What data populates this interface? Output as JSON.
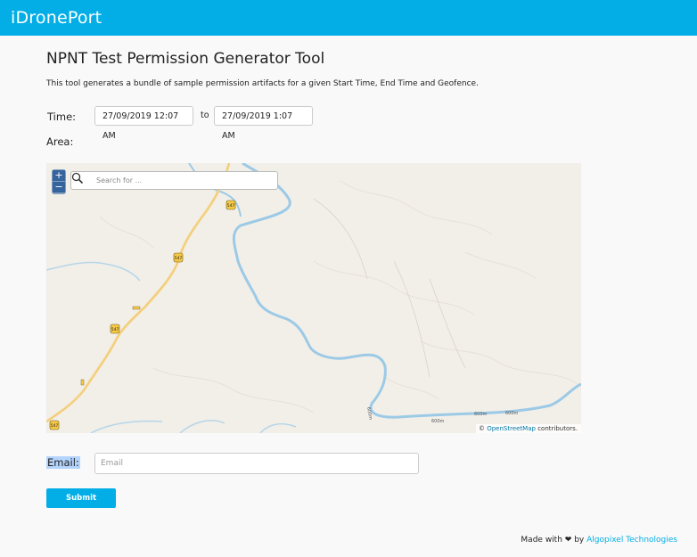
{
  "header": {
    "brand": "iDronePort",
    "color": "#03aee6"
  },
  "page": {
    "title": "NPNT Test Permission Generator Tool",
    "description": "This tool generates a bundle of sample permission artifacts for a given Start Time, End Time and Geofence."
  },
  "form": {
    "time_label": "Time:",
    "start_time": "27/09/2019 12:07 AM",
    "to_label": "to",
    "end_time": "27/09/2019 1:07 AM",
    "area_label": "Area:",
    "email_label": "Email:",
    "email_placeholder": "Email",
    "submit_label": "Submit"
  },
  "map": {
    "zoom_in": "+",
    "zoom_out": "−",
    "search_placeholder": "Search for ...",
    "attribution_prefix": "©",
    "attribution_link": "OpenStreetMap",
    "attribution_suffix": "contributors.",
    "road_labels": [
      "547",
      "547",
      "547",
      "547"
    ],
    "river_labels": [
      "600m",
      "600m",
      "600m",
      "600m"
    ],
    "colors": {
      "land": "#f2efe9",
      "water": "#aad3df",
      "river": "#9ccae6",
      "road": "#f7d68d"
    }
  },
  "footer": {
    "made_with": "Made with",
    "heart": "❤",
    "by": "by",
    "company": "Algopixel Technologies"
  }
}
